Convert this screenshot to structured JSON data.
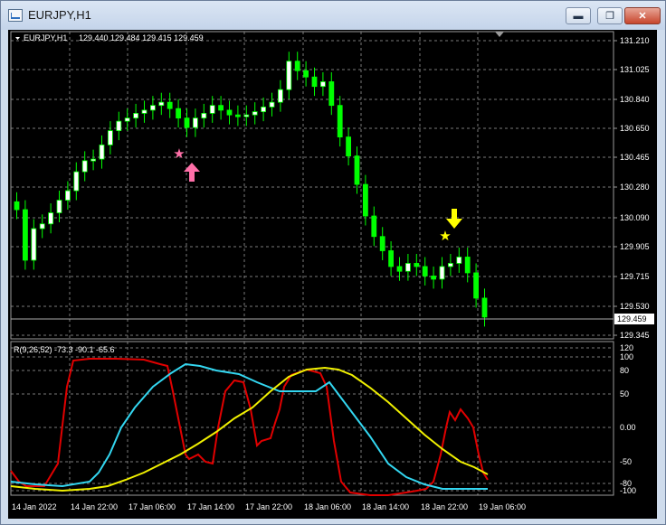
{
  "window": {
    "title": "EURJPY,H1",
    "minimize_glyph": "▬",
    "maximize_glyph": "❐",
    "close_glyph": "✕"
  },
  "price_panel": {
    "symbol_label": "EURJPY,H1",
    "ohlc": "129.440 129.484 129.415 129.459",
    "current_price": "129.459",
    "price_ticks": [
      "131.210",
      "131.025",
      "130.840",
      "130.650",
      "130.465",
      "130.280",
      "130.090",
      "129.905",
      "129.715",
      "129.530",
      "129.345"
    ],
    "buy_signal_icon": "pink-up-arrow-and-star",
    "sell_signal_icon": "yellow-down-arrow-and-star"
  },
  "indicator_panel": {
    "label": "R(9,26,52) -73.3 -90.1 -65.6",
    "ticks": [
      "120",
      "100",
      "80",
      "50",
      "0.00",
      "-50",
      "-80",
      "-100"
    ]
  },
  "time_axis": {
    "labels": [
      "14 Jan 2022",
      "14 Jan 22:00",
      "17 Jan 06:00",
      "17 Jan 14:00",
      "17 Jan 22:00",
      "18 Jan 06:00",
      "18 Jan 14:00",
      "18 Jan 22:00",
      "19 Jan 06:00"
    ]
  },
  "colors": {
    "background": "#000000",
    "bull_candle": "#ffffff",
    "bear_candle": "#00ff00",
    "grid": "#7a7a7a",
    "text": "#ffffff",
    "rsi_red": "#e00000",
    "rsi_cyan": "#33d6f0",
    "rsi_yellow": "#f0f000",
    "buy_signal": "#ff6fa8",
    "sell_signal": "#ffff00"
  },
  "chart_data": {
    "type": "candlestick",
    "candles_approx_close": [
      130.14,
      129.82,
      130.02,
      130.05,
      130.12,
      130.2,
      130.26,
      130.38,
      130.45,
      130.46,
      130.55,
      130.64,
      130.7,
      130.72,
      130.75,
      130.77,
      130.8,
      130.82,
      130.78,
      130.72,
      130.66,
      130.72,
      130.75,
      130.8,
      130.77,
      130.74,
      130.73,
      130.74,
      130.76,
      130.79,
      130.82,
      130.9,
      131.08,
      131.02,
      130.98,
      130.92,
      130.95,
      130.8,
      130.6,
      130.48,
      130.3,
      130.1,
      129.97,
      129.88,
      129.78,
      129.75,
      129.8,
      129.78,
      129.72,
      129.7,
      129.78,
      129.8,
      129.84,
      129.74,
      129.58,
      129.46
    ],
    "ylim": [
      129.345,
      131.21
    ],
    "oscillator": {
      "series": [
        {
          "name": "R(9)",
          "last": -73.3
        },
        {
          "name": "R(26)",
          "last": -90.1
        },
        {
          "name": "R(52)",
          "last": -65.6
        }
      ],
      "ylim": [
        -100,
        120
      ]
    }
  }
}
